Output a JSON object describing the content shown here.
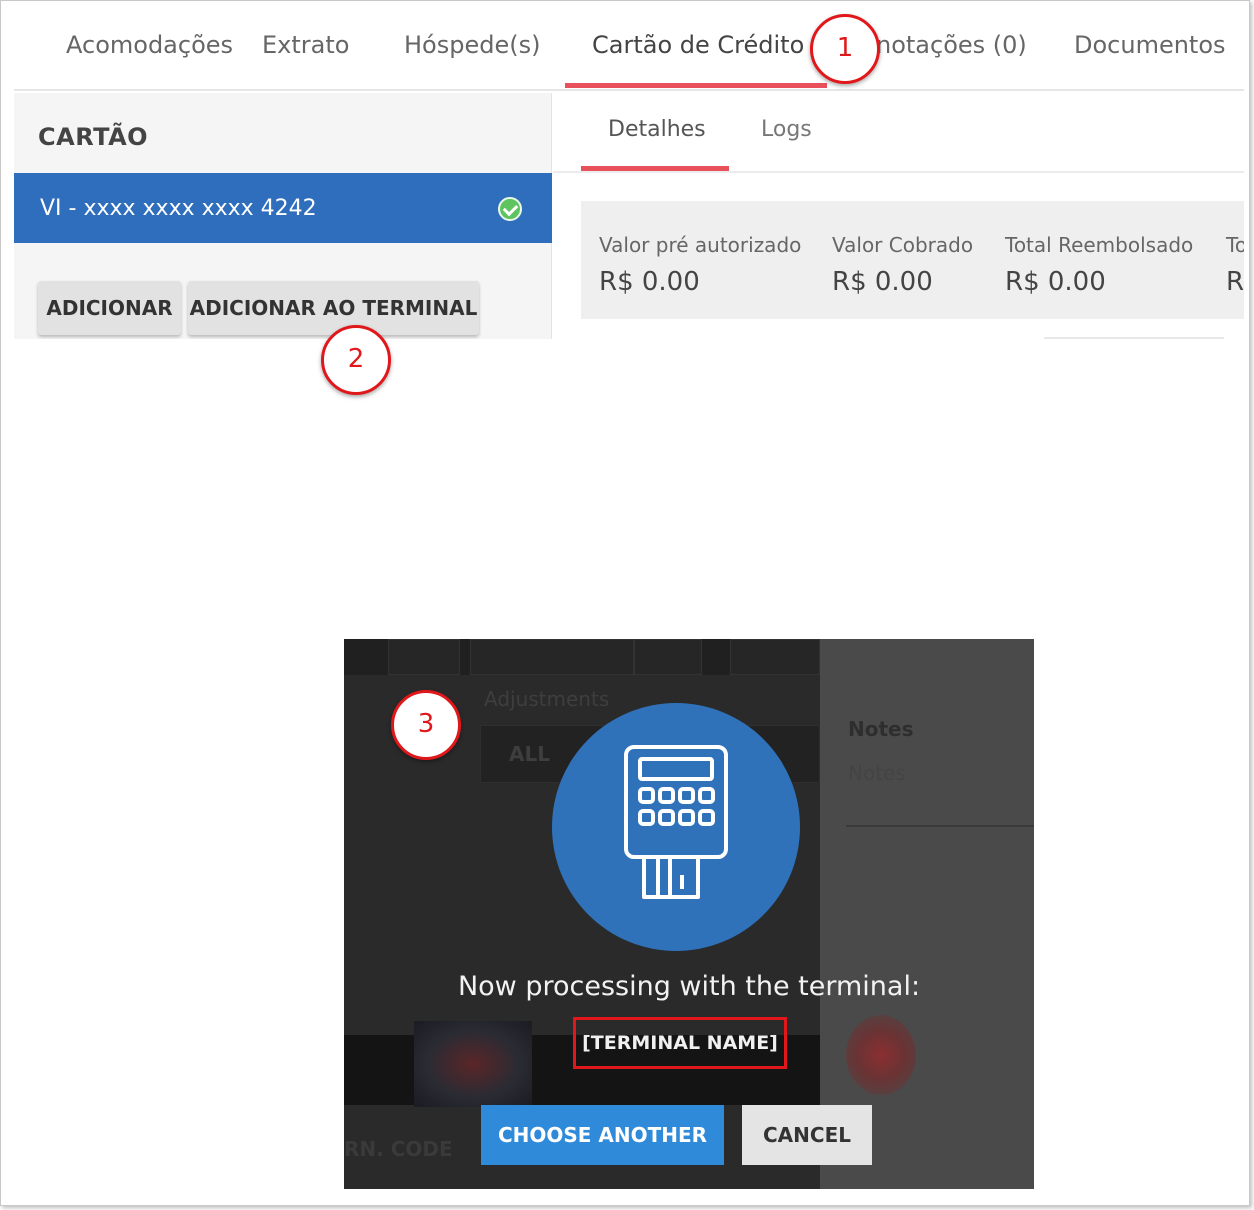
{
  "main_tabs": [
    {
      "label": "Acomodações"
    },
    {
      "label": "Extrato"
    },
    {
      "label": "Hóspede(s)"
    },
    {
      "label": "Cartão de Crédito"
    },
    {
      "label": "notações (0)"
    },
    {
      "label": "Documentos"
    }
  ],
  "card_panel": {
    "title": "CARTÃO",
    "card_label": "VI - xxxx xxxx xxxx 4242",
    "add_button": "ADICIONAR",
    "add_terminal_button": "ADICIONAR AO TERMINAL"
  },
  "sub_tabs": [
    {
      "label": "Detalhes"
    },
    {
      "label": "Logs"
    }
  ],
  "summary": [
    {
      "label": "Valor pré autorizado",
      "value": "R$ 0.00"
    },
    {
      "label": "Valor Cobrado",
      "value": "R$ 0.00"
    },
    {
      "label": "Total Reembolsado",
      "value": "R$ 0.00"
    },
    {
      "label": "To",
      "value": "R"
    }
  ],
  "steps": [
    "1",
    "2",
    "3"
  ],
  "modal": {
    "bg_adjustments_label": "Adjustments",
    "bg_select_value": "ALL",
    "bg_notes_label": "Notes",
    "bg_notes_placeholder": "Notes",
    "bg_corner_text": "RN. CODE",
    "processing_text": "Now processing with the terminal:",
    "terminal_name": "[TERMINAL NAME]",
    "choose_another": "CHOOSE ANOTHER",
    "cancel": "CANCEL"
  },
  "colors": {
    "accent_red": "#e8505b",
    "card_blue": "#2f6dbd",
    "annotation_red": "#e0181b",
    "terminal_blue": "#2f72ba",
    "button_blue": "#2f8ad9"
  }
}
